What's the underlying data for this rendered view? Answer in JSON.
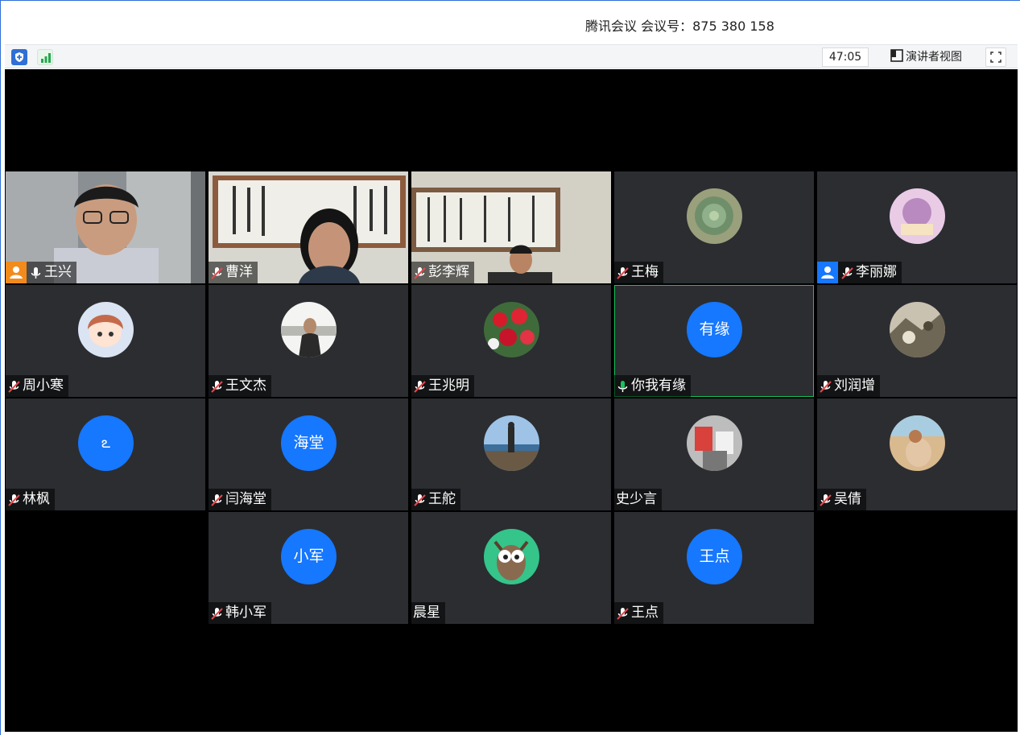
{
  "window": {
    "title": "腾讯会议 会议号：875 380 158"
  },
  "toolbar": {
    "security_icon": "shield-icon",
    "signal_icon": "signal-icon",
    "timer": "47:05",
    "speaker_view_label": "演讲者视图",
    "fullscreen_icon": "fullscreen-icon"
  },
  "colors": {
    "accent": "#1677ff",
    "host": "#f28b1c",
    "mic_muted": "#e5484d",
    "mic_active": "#19c25a",
    "tile_bg": "#2b2d31"
  },
  "participants": [
    {
      "name": "王兴",
      "badge": "host",
      "mic": "on",
      "media": "video"
    },
    {
      "name": "曹洋",
      "mic": "muted",
      "media": "video"
    },
    {
      "name": "彭李辉",
      "mic": "muted",
      "media": "video"
    },
    {
      "name": "王梅",
      "mic": "muted",
      "media": "photo-avatar"
    },
    {
      "name": "李丽娜",
      "badge": "cohost",
      "mic": "muted",
      "media": "photo-avatar"
    },
    {
      "name": "周小寒",
      "mic": "muted",
      "media": "photo-avatar"
    },
    {
      "name": "王文杰",
      "mic": "muted",
      "media": "photo-avatar"
    },
    {
      "name": "王兆明",
      "mic": "muted",
      "media": "photo-avatar"
    },
    {
      "name": "你我有缘",
      "mic": "speaking",
      "media": "text-avatar",
      "avatar_text": "有缘"
    },
    {
      "name": "刘润增",
      "mic": "muted",
      "media": "photo-avatar"
    },
    {
      "name": "林枫",
      "mic": "muted",
      "media": "text-avatar",
      "avatar_text": "ఽ"
    },
    {
      "name": "闫海堂",
      "mic": "muted",
      "media": "text-avatar",
      "avatar_text": "海堂"
    },
    {
      "name": "王舵",
      "mic": "muted",
      "media": "photo-avatar"
    },
    {
      "name": "史少言",
      "mic": "none",
      "media": "photo-avatar"
    },
    {
      "name": "吴倩",
      "mic": "muted",
      "media": "photo-avatar"
    },
    {
      "name": "韩小军",
      "mic": "muted",
      "media": "text-avatar",
      "avatar_text": "小军"
    },
    {
      "name": "晨星",
      "mic": "none",
      "media": "photo-avatar"
    },
    {
      "name": "王点",
      "mic": "muted",
      "media": "text-avatar",
      "avatar_text": "王点"
    }
  ]
}
